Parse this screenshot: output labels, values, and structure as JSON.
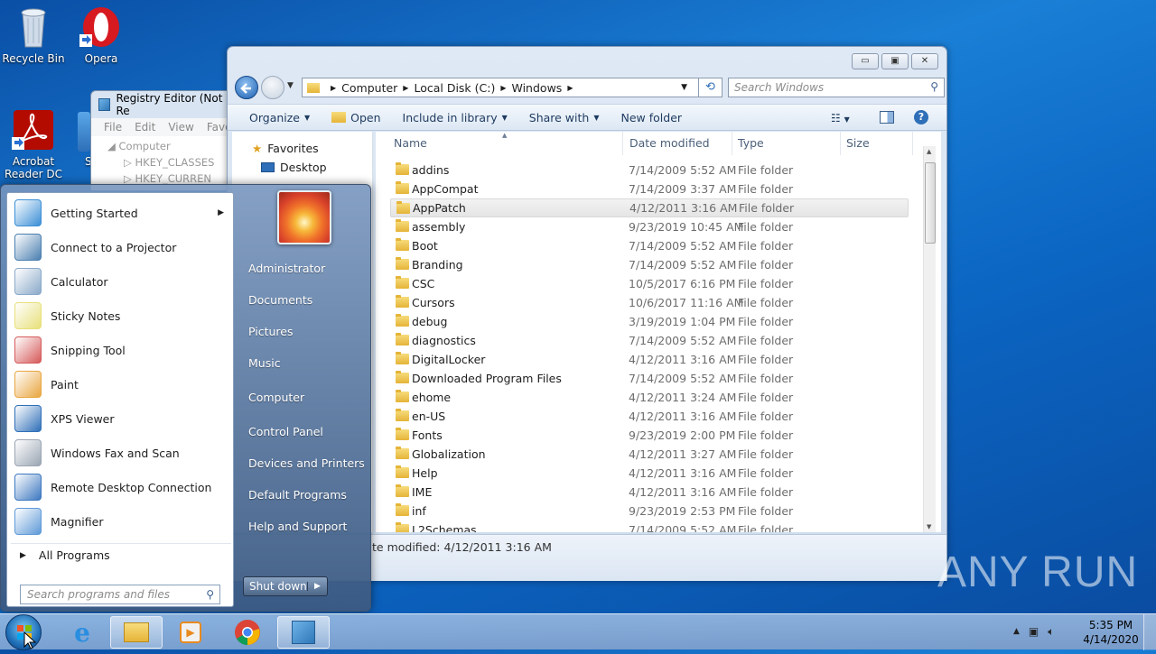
{
  "desktop": {
    "icons": [
      {
        "label": "Recycle Bin",
        "icon": "recycle-bin-icon"
      },
      {
        "label": "Opera",
        "icon": "opera-icon"
      },
      {
        "label": "Acrobat Reader DC",
        "line1": "Acrobat",
        "line2": "Reader DC",
        "icon": "acrobat-icon"
      },
      {
        "label": "S",
        "icon": "partial-desktop-icon"
      }
    ]
  },
  "registry": {
    "title": "Registry Editor (Not Re",
    "menu": [
      "File",
      "Edit",
      "View",
      "Favor"
    ],
    "tree": [
      "Computer",
      "HKEY_CLASSES",
      "HKEY_CURREN"
    ]
  },
  "explorer": {
    "breadcrumb": [
      "Computer",
      "Local Disk (C:)",
      "Windows"
    ],
    "search_placeholder": "Search Windows",
    "commands": [
      "Organize",
      "Open",
      "Include in library",
      "Share with",
      "New folder"
    ],
    "nav": {
      "favorites": "Favorites",
      "desktop": "Desktop"
    },
    "columns": [
      "Name",
      "Date modified",
      "Type",
      "Size"
    ],
    "rows": [
      {
        "name": "addins",
        "date": "7/14/2009 5:52 AM",
        "type": "File folder"
      },
      {
        "name": "AppCompat",
        "date": "7/14/2009 3:37 AM",
        "type": "File folder"
      },
      {
        "name": "AppPatch",
        "date": "4/12/2011 3:16 AM",
        "type": "File folder"
      },
      {
        "name": "assembly",
        "date": "9/23/2019 10:45 AM",
        "type": "File folder"
      },
      {
        "name": "Boot",
        "date": "7/14/2009 5:52 AM",
        "type": "File folder"
      },
      {
        "name": "Branding",
        "date": "7/14/2009 5:52 AM",
        "type": "File folder"
      },
      {
        "name": "CSC",
        "date": "10/5/2017 6:16 PM",
        "type": "File folder"
      },
      {
        "name": "Cursors",
        "date": "10/6/2017 11:16 AM",
        "type": "File folder"
      },
      {
        "name": "debug",
        "date": "3/19/2019 1:04 PM",
        "type": "File folder"
      },
      {
        "name": "diagnostics",
        "date": "7/14/2009 5:52 AM",
        "type": "File folder"
      },
      {
        "name": "DigitalLocker",
        "date": "4/12/2011 3:16 AM",
        "type": "File folder"
      },
      {
        "name": "Downloaded Program Files",
        "date": "7/14/2009 5:52 AM",
        "type": "File folder"
      },
      {
        "name": "ehome",
        "date": "4/12/2011 3:24 AM",
        "type": "File folder"
      },
      {
        "name": "en-US",
        "date": "4/12/2011 3:16 AM",
        "type": "File folder"
      },
      {
        "name": "Fonts",
        "date": "9/23/2019 2:00 PM",
        "type": "File folder"
      },
      {
        "name": "Globalization",
        "date": "4/12/2011 3:27 AM",
        "type": "File folder"
      },
      {
        "name": "Help",
        "date": "4/12/2011 3:16 AM",
        "type": "File folder"
      },
      {
        "name": "IME",
        "date": "4/12/2011 3:16 AM",
        "type": "File folder"
      },
      {
        "name": "inf",
        "date": "9/23/2019 2:53 PM",
        "type": "File folder"
      },
      {
        "name": "L2Schemas",
        "date": "7/14/2009 5:52 AM",
        "type": "File folder"
      }
    ],
    "selected_index": 2,
    "details_text": "te modified: 4/12/2011 3:16 AM"
  },
  "start_menu": {
    "programs": [
      {
        "label": "Getting Started",
        "icon": "getting-started-icon",
        "color": "#3b8fd6",
        "has_arrow": true
      },
      {
        "label": "Connect to a Projector",
        "icon": "projector-icon",
        "color": "#4a7fb0"
      },
      {
        "label": "Calculator",
        "icon": "calculator-icon",
        "color": "#8aa9c9"
      },
      {
        "label": "Sticky Notes",
        "icon": "sticky-notes-icon",
        "color": "#e8e07a"
      },
      {
        "label": "Snipping Tool",
        "icon": "snipping-tool-icon",
        "color": "#d65a5a"
      },
      {
        "label": "Paint",
        "icon": "paint-icon",
        "color": "#e9a640"
      },
      {
        "label": "XPS Viewer",
        "icon": "xps-viewer-icon",
        "color": "#2f6fb8"
      },
      {
        "label": "Windows Fax and Scan",
        "icon": "fax-scan-icon",
        "color": "#9aa5b3"
      },
      {
        "label": "Remote Desktop Connection",
        "icon": "remote-desktop-icon",
        "color": "#3c78c0"
      },
      {
        "label": "Magnifier",
        "icon": "magnifier-icon",
        "color": "#5f9ad8"
      }
    ],
    "all_programs": "All Programs",
    "search_placeholder": "Search programs and files",
    "right_items": [
      "Administrator",
      "Documents",
      "Pictures",
      "Music",
      "Computer",
      "Control Panel",
      "Devices and Printers",
      "Default Programs",
      "Help and Support"
    ],
    "shutdown": "Shut down"
  },
  "taskbar": {
    "buttons": [
      "start-orb",
      "internet-explorer-icon",
      "explorer-icon",
      "media-player-icon",
      "chrome-icon",
      "registry-editor-icon"
    ],
    "time": "5:35 PM",
    "date": "4/14/2020"
  },
  "watermark": "ANY RUN"
}
